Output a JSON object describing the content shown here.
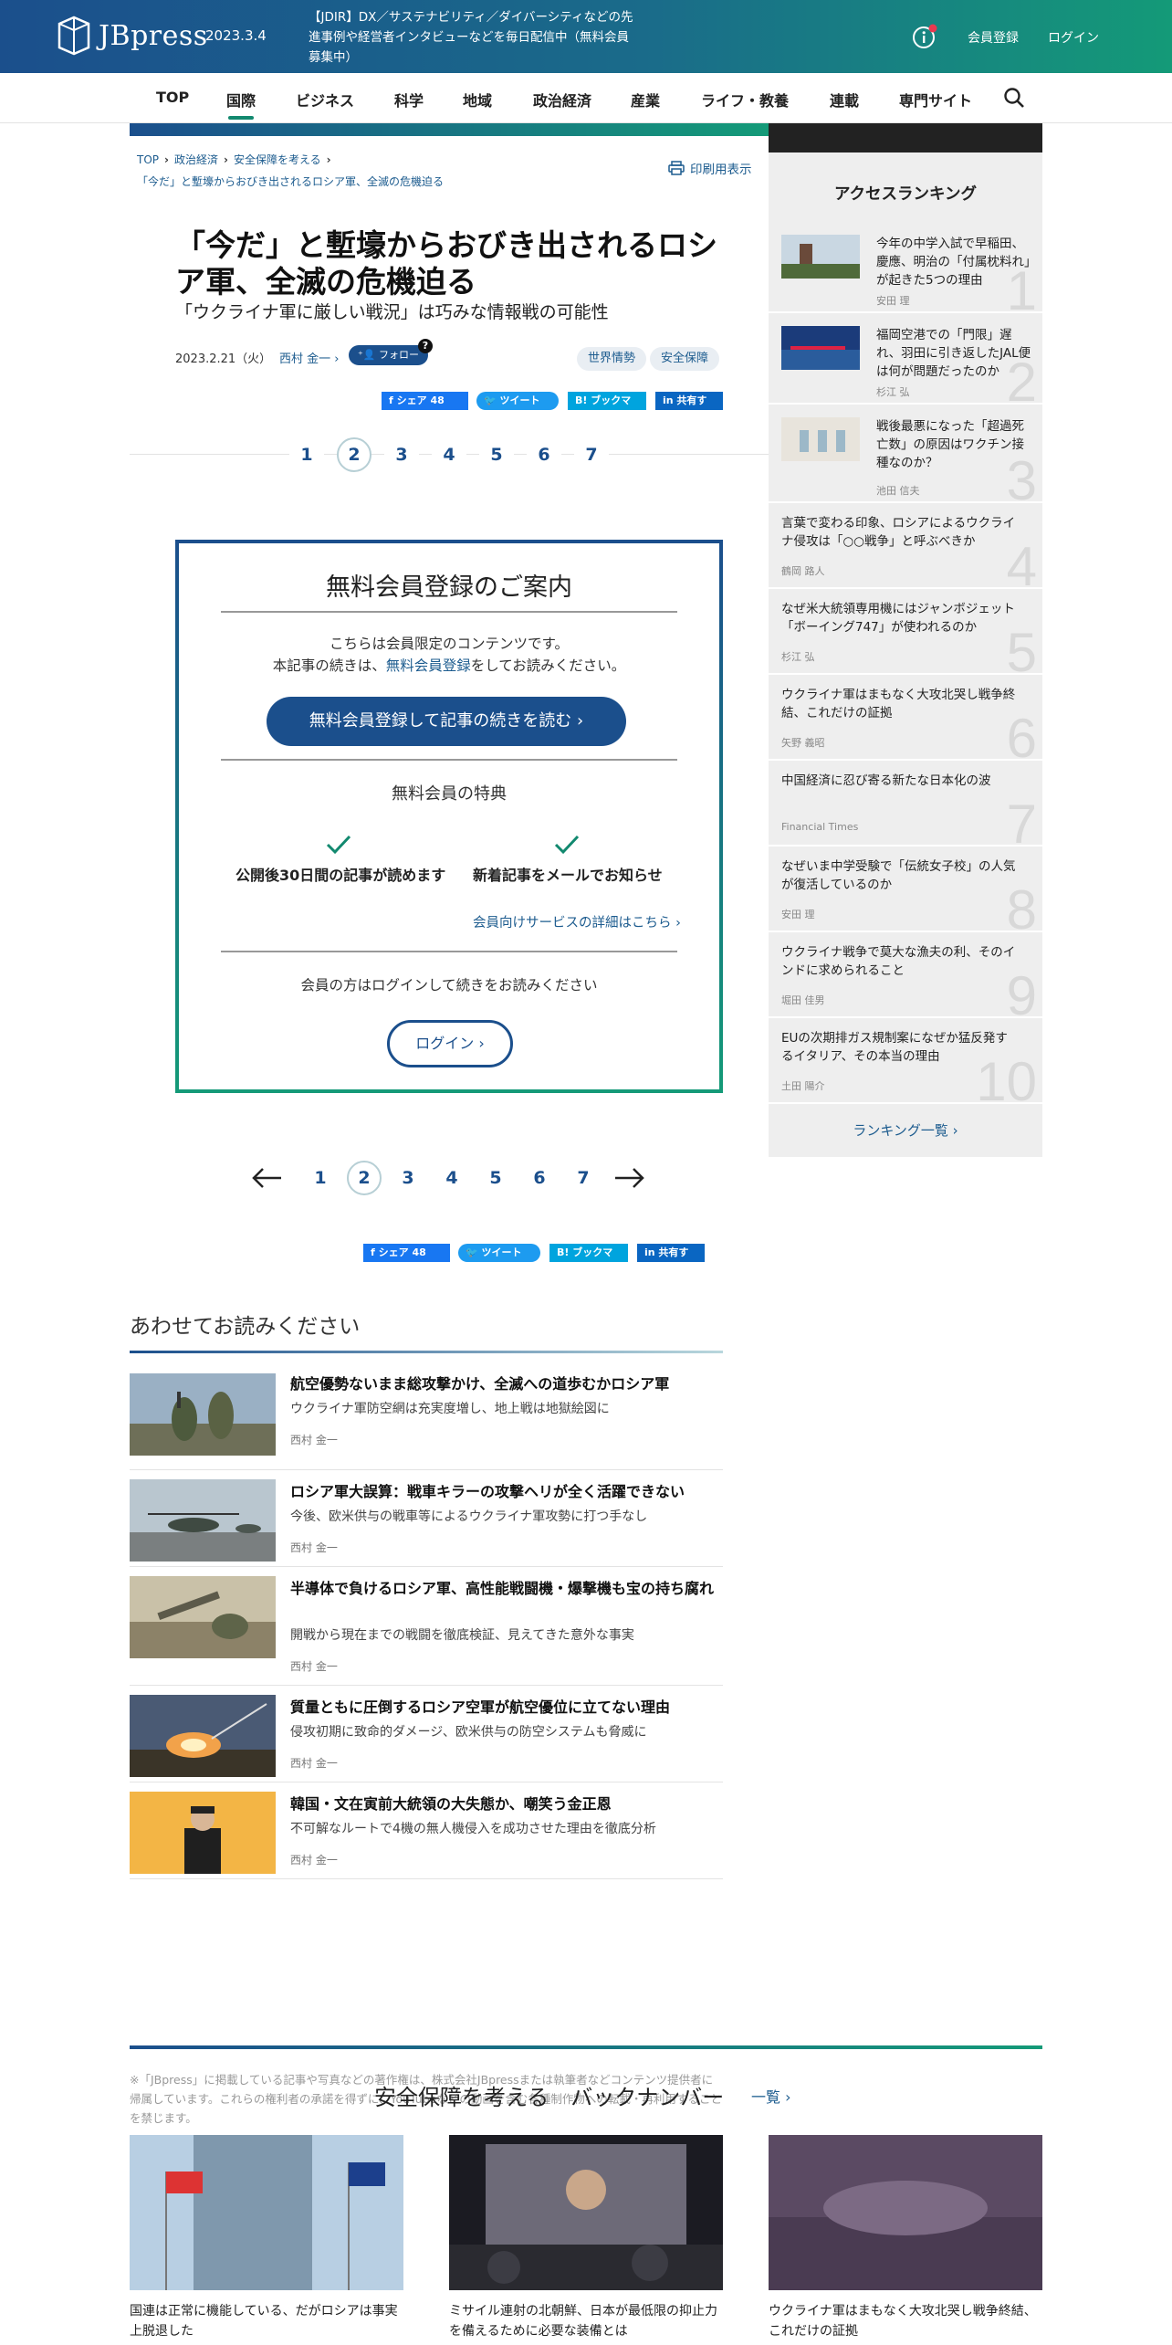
{
  "header": {
    "brand": "JBpress",
    "date": "2023.3.4",
    "notice": "【JDIR】DX／サステナビリティ／ダイバーシティなどの先進事例や経営者インタビューなどを毎日配信中（無料会員募集中）",
    "register": "会員登録",
    "login": "ログイン"
  },
  "nav": {
    "items": [
      "TOP",
      "国際",
      "ビジネス",
      "科学",
      "地域",
      "政治経済",
      "産業",
      "ライフ・教養",
      "連載",
      "専門サイト"
    ],
    "active": "国際"
  },
  "article": {
    "breadcrumb": [
      "TOP",
      "政治経済",
      "安全保障を考える",
      "「今だ」と塹壕からおびき出されるロシア軍、全滅の危機迫る"
    ],
    "print": "印刷用表示",
    "title": "「今だ」と塹壕からおびき出されるロシア軍、全滅の危機迫る",
    "subtitle": "「ウクライナ軍に厳しい戦況」は巧みな情報戦の可能性",
    "date": "2023.2.21（火）",
    "author": "西村 金一",
    "follow": "フォロー",
    "follow_help": "?",
    "tags": [
      "世界情勢",
      "安全保障"
    ],
    "share": {
      "facebook": "シェア",
      "facebook_count": "48",
      "twitter": "ツイート",
      "hatena": "B! ブックマーク",
      "linkedin": "in 共有する"
    },
    "pages": [
      "1",
      "2",
      "3",
      "4",
      "5",
      "6",
      "7"
    ],
    "current_page": "2"
  },
  "registration": {
    "title": "無料会員登録のご案内",
    "line1": "こちらは会員限定のコンテンツです。",
    "line2_pre": "本記事の続きは、",
    "line2_link": "無料会員登録",
    "line2_post": "をしてお読みください。",
    "cta": "無料会員登録して記事の続きを読む ›",
    "benefits_title": "無料会員の特典",
    "benefit1": "公開後30日間の記事が読めます",
    "benefit2": "新着記事をメールでお知らせ",
    "service_link": "会員向けサービスの詳細はこちら ›",
    "login_note": "会員の方はログインして続きをお読みください",
    "login_button": "ログイン ›"
  },
  "related": {
    "heading": "あわせてお読みください",
    "items": [
      {
        "title": "航空優勢ないまま総攻撃かけ、全滅への道歩むかロシア軍",
        "desc": "ウクライナ軍防空網は充実度増し、地上戦は地獄絵図に",
        "author": "西村 金一"
      },
      {
        "title": "ロシア軍大誤算：戦車キラーの攻撃ヘリが全く活躍できない",
        "desc": "今後、欧米供与の戦車等によるウクライナ軍攻勢に打つ手なし",
        "author": "西村 金一"
      },
      {
        "title": "半導体で負けるロシア軍、高性能戦闘機・爆撃機も宝の持ち腐れ",
        "desc": "開戦から現在までの戦闘を徹底検証、見えてきた意外な事実",
        "author": "西村 金一"
      },
      {
        "title": "質量ともに圧倒するロシア空軍が航空優位に立てない理由",
        "desc": "侵攻初期に致命的ダメージ、欧米供与の防空システムも脅威に",
        "author": "西村 金一"
      },
      {
        "title": "韓国・文在寅前大統領の大失態か、嘲笑う金正恩",
        "desc": "不可解なルートで4機の無人機侵入を成功させた理由を徹底分析",
        "author": "西村 金一"
      }
    ]
  },
  "copyright": "※「JBpress」に掲載している記事や写真などの著作権は、株式会社JBpressまたは執筆者などコンテンツ提供者に帰属しています。これらの権利者の承諾を得ずに、YouTubeなどの動画を含む各種制作物への転載・再利用することを禁じます。",
  "ranking": {
    "title": "アクセスランキング",
    "items": [
      {
        "rank": "1",
        "title": "今年の中学入試で早稲田、慶應、明治の「付属枕料れ」が起きた5つの理由",
        "author": "安田 理"
      },
      {
        "rank": "2",
        "title": "福岡空港での「門限」遅れ、羽田に引き返したJAL便は何が問題だったのか",
        "author": "杉江 弘"
      },
      {
        "rank": "3",
        "title": "戦後最悪になった「超過死亡数」の原因はワクチン接種なのか？",
        "author": "池田 信夫"
      },
      {
        "rank": "4",
        "title": "言葉で変わる印象、ロシアによるウクライナ侵攻は「○○戦争」と呼ぶべきか",
        "author": "鶴岡 路人"
      },
      {
        "rank": "5",
        "title": "なぜ米大統領専用機にはジャンボジェット「ボーイング747」が使われるのか",
        "author": "杉江 弘"
      },
      {
        "rank": "6",
        "title": "ウクライナ軍はまもなく大攻北哭し戦争終結、これだけの証拠",
        "author": "矢野 義昭"
      },
      {
        "rank": "7",
        "title": "中国経済に忍び寄る新たな日本化の波",
        "author": "Financial Times"
      },
      {
        "rank": "8",
        "title": "なぜいま中学受験で「伝統女子校」の人気が復活しているのか",
        "author": "安田 理"
      },
      {
        "rank": "9",
        "title": "ウクライナ戦争で莫大な漁夫の利、そのインドに求められること",
        "author": "堀田 佳男"
      },
      {
        "rank": "10",
        "title": "EUの次期排ガス規制案になぜか猛反発するイタリア、その本当の理由",
        "author": "土田 陽介"
      }
    ],
    "more": "ランキング一覧 ›"
  },
  "backnumber": {
    "heading": "安全保障を考える　バックナンバー",
    "more": "一覧 ›",
    "items": [
      {
        "title": "国連は正常に機能している、だがロシアは事実上脱退した"
      },
      {
        "title": "ミサイル連射の北朝鮮、日本が最低限の抑止力を備えるために必要な装備とは"
      },
      {
        "title": "ウクライナ軍はまもなく大攻北哭し戦争終結、これだけの証拠"
      }
    ]
  }
}
